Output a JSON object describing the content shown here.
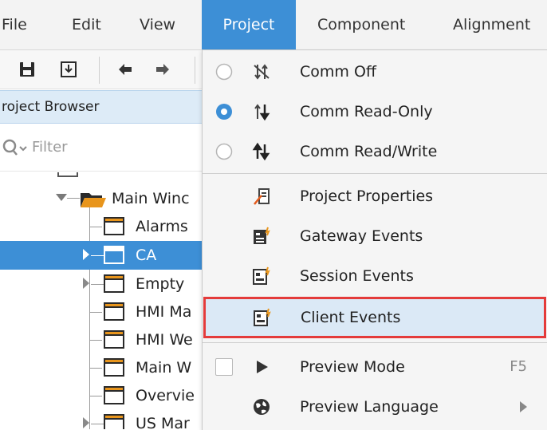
{
  "menubar": {
    "items": [
      {
        "label": "File"
      },
      {
        "label": "Edit"
      },
      {
        "label": "View"
      },
      {
        "label": "Project"
      },
      {
        "label": "Component"
      },
      {
        "label": "Alignment"
      }
    ]
  },
  "colors": {
    "accent": "#3d8fd6",
    "highlight_border": "#e43b3b",
    "highlight_bg": "#dbe9f6"
  },
  "toolbar": {
    "icons": [
      "save-icon",
      "save-all-icon",
      "undo-icon",
      "redo-icon"
    ]
  },
  "project_browser": {
    "title": "roject Browser",
    "filter_placeholder": "Filter"
  },
  "tree": {
    "folder_label": "Main Winc",
    "items": [
      {
        "label": "Alarms"
      },
      {
        "label": "CA"
      },
      {
        "label": "Empty"
      },
      {
        "label": "HMI Ma"
      },
      {
        "label": "HMI We"
      },
      {
        "label": "Main W"
      },
      {
        "label": "Overvie"
      },
      {
        "label": "US Mar"
      }
    ]
  },
  "project_menu": {
    "items": [
      {
        "label": "Comm Off",
        "icon": "comm-off-icon",
        "radio": "unchecked"
      },
      {
        "label": "Comm Read-Only",
        "icon": "comm-read-only-icon",
        "radio": "checked"
      },
      {
        "label": "Comm Read/Write",
        "icon": "comm-read-write-icon",
        "radio": "unchecked"
      },
      {
        "label": "Project Properties",
        "icon": "project-properties-icon"
      },
      {
        "label": "Gateway Events",
        "icon": "gateway-events-icon"
      },
      {
        "label": "Session Events",
        "icon": "session-events-icon"
      },
      {
        "label": "Client Events",
        "icon": "client-events-icon",
        "highlighted": true
      },
      {
        "label": "Preview Mode",
        "icon": "play-icon",
        "shortcut": "F5",
        "checkbox": "unchecked"
      },
      {
        "label": "Preview Language",
        "icon": "globe-icon",
        "submenu": true
      }
    ]
  }
}
